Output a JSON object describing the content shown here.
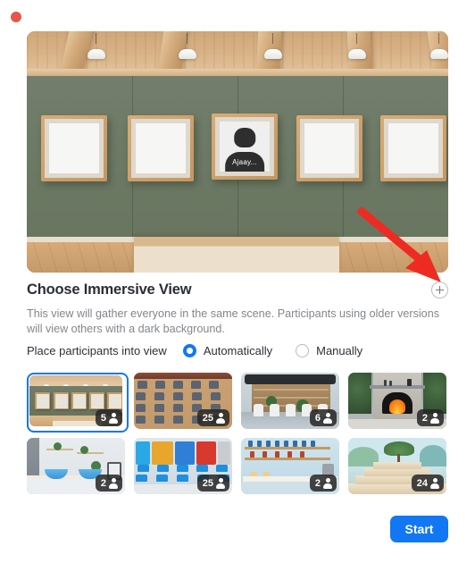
{
  "window": {
    "close_dot_color": "#e8564a"
  },
  "preview": {
    "scene_name": "gallery-room",
    "avatar_name": "Ajaay...",
    "frame_count": 5
  },
  "annotation": {
    "arrow_color": "#ee2b23",
    "points_to": "add-immersive-view-button"
  },
  "header": {
    "title": "Choose Immersive View",
    "add_button_icon": "plus-circle-icon"
  },
  "description": "This view will gather everyone in the same scene. Participants using older versions will view others with a dark background.",
  "placement": {
    "label": "Place participants into view",
    "selected": "Automatically",
    "options": [
      {
        "label": "Automatically",
        "selected": true
      },
      {
        "label": "Manually",
        "selected": false
      }
    ]
  },
  "scenes": [
    {
      "name": "gallery-room",
      "capacity": "5",
      "selected": true
    },
    {
      "name": "lecture-hall",
      "capacity": "25",
      "selected": false
    },
    {
      "name": "modern-cafe",
      "capacity": "6",
      "selected": false
    },
    {
      "name": "outdoor-fireplace",
      "capacity": "2",
      "selected": false
    },
    {
      "name": "spa-bathroom",
      "capacity": "2",
      "selected": false
    },
    {
      "name": "classroom",
      "capacity": "25",
      "selected": false
    },
    {
      "name": "bakery-kitchen",
      "capacity": "2",
      "selected": false
    },
    {
      "name": "amphitheatre",
      "capacity": "24",
      "selected": false
    }
  ],
  "footer": {
    "start_label": "Start",
    "start_color": "#1277f2"
  }
}
